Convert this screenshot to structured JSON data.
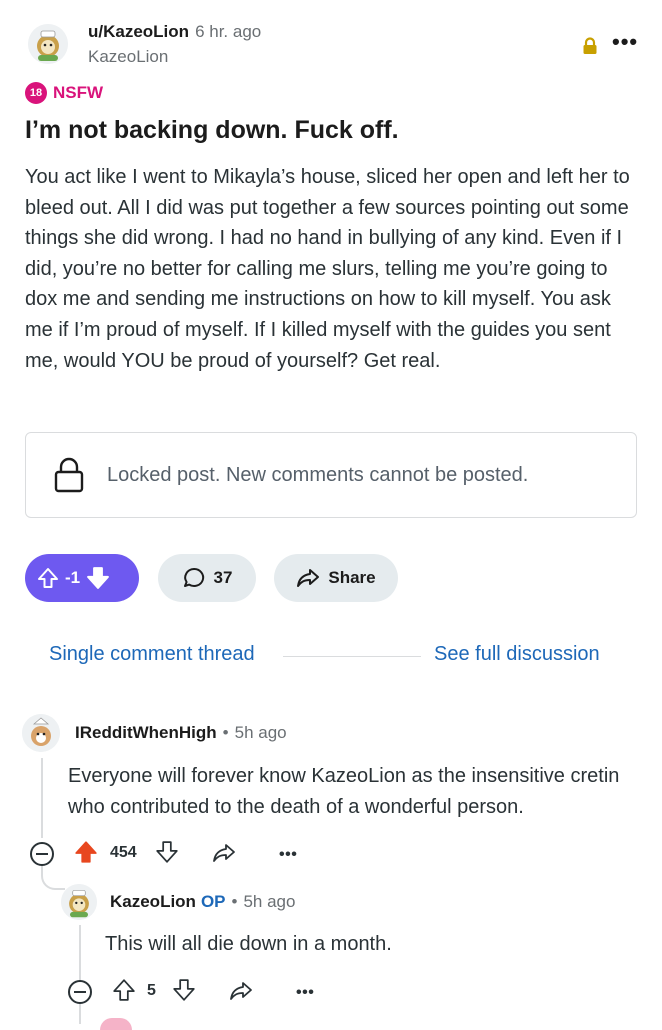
{
  "post": {
    "author": "u/KazeoLion",
    "time": "6 hr. ago",
    "subtitle": "KazeoLion",
    "nsfw_badge": "18",
    "nsfw_label": "NSFW",
    "title": "I’m not backing down. Fuck off.",
    "body": "You act like I went to Mikayla’s house, sliced her open and left her to bleed out. All I did was put together a few sources pointing out some things she did wrong. I had no hand in bullying of any kind. Even if I did, you’re no better for calling me slurs, telling me you’re going to dox me and sending me instructions on how to kill myself. You ask me if I’m proud of myself. If I killed myself with the guides you sent me, would YOU be proud of yourself? Get real.",
    "locked_notice": "Locked post. New comments cannot be posted.",
    "vote_count": "-1",
    "comment_count": "37",
    "share_label": "Share"
  },
  "thread_nav": {
    "single_thread": "Single comment thread",
    "full_discussion": "See full discussion"
  },
  "comments": [
    {
      "author": "IRedditWhenHigh",
      "dot": "•",
      "time": "5h ago",
      "body": "Everyone will forever know KazeoLion as the insensitive cretin who contributed to the death of a wonderful person.",
      "votes": "454",
      "more": "•••"
    },
    {
      "author": "KazeoLion",
      "op": "OP",
      "dot": "•",
      "time": "5h ago",
      "body": "This will all die down in a month.",
      "votes": "5",
      "more": "•••"
    }
  ],
  "colors": {
    "upvote_accent": "#6e59f0",
    "upvoted_orange": "#e8471f",
    "nsfw": "#d9137b",
    "link": "#1d68b8",
    "lock": "#c8a000"
  },
  "icons": {
    "post_avatar": "lion-avatar-icon",
    "lock": "lock-icon",
    "more": "more-icon",
    "upvote": "upvote-arrow-icon",
    "downvote": "downvote-arrow-icon",
    "comment": "comment-bubble-icon",
    "share": "share-arrow-icon",
    "collapse": "collapse-icon"
  }
}
